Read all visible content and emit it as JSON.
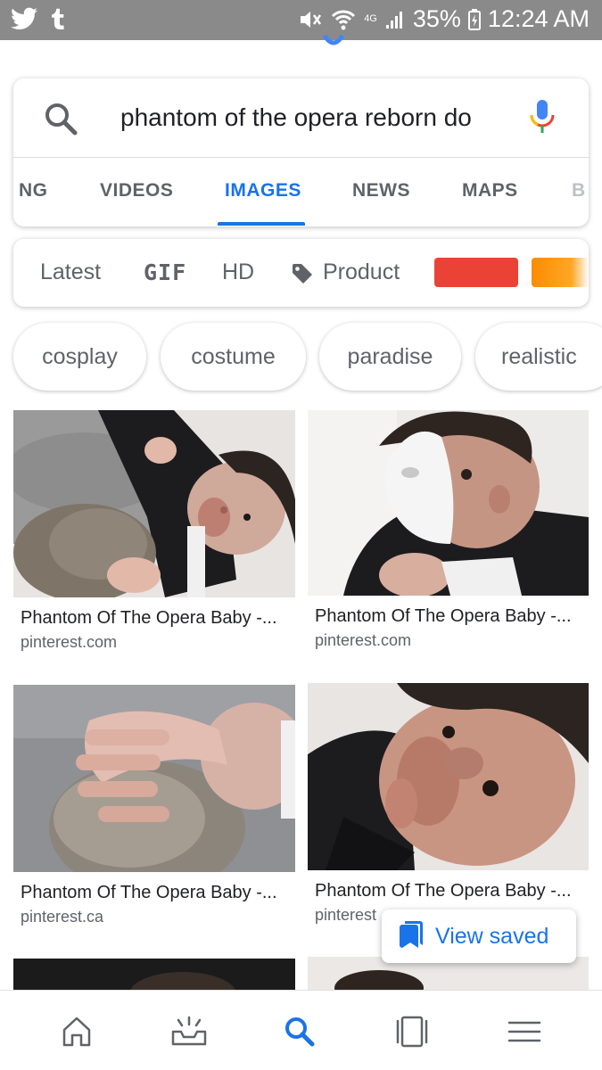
{
  "status_bar": {
    "battery": "35%",
    "time": "12:24 AM",
    "left_icons": [
      "twitter-icon",
      "tumblr-icon"
    ],
    "right_icons": [
      "mute-icon",
      "wifi-icon",
      "signal-icon",
      "battery-charging-icon"
    ],
    "network_badge": "4G"
  },
  "search": {
    "query": "phantom of the opera reborn do",
    "tabs": [
      {
        "label": "NG",
        "active": false
      },
      {
        "label": "VIDEOS",
        "active": false
      },
      {
        "label": "IMAGES",
        "active": true
      },
      {
        "label": "NEWS",
        "active": false
      },
      {
        "label": "MAPS",
        "active": false
      },
      {
        "label": "B",
        "active": false
      }
    ]
  },
  "filters": {
    "latest": "Latest",
    "gif": "GIF",
    "hd": "HD",
    "product": "Product",
    "color_swatches": [
      "#ea4335",
      "#fb8c00"
    ]
  },
  "chips": [
    "cosplay",
    "costume",
    "paradise",
    "realistic"
  ],
  "results": [
    {
      "title": "Phantom Of The Opera Baby -...",
      "source": "pinterest.com"
    },
    {
      "title": "Phantom Of The Opera Baby -...",
      "source": "pinterest.com"
    },
    {
      "title": "Phantom Of The Opera Baby -...",
      "source": "pinterest.ca"
    },
    {
      "title": "Phantom Of The Opera Baby -...",
      "source": "pinterest"
    }
  ],
  "view_saved": {
    "label": "View saved"
  },
  "bottom_nav": {
    "items": [
      "home-icon",
      "updates-icon",
      "search-icon",
      "tabs-icon",
      "menu-icon"
    ],
    "active": "search-icon",
    "accent": "#1a73e8"
  }
}
